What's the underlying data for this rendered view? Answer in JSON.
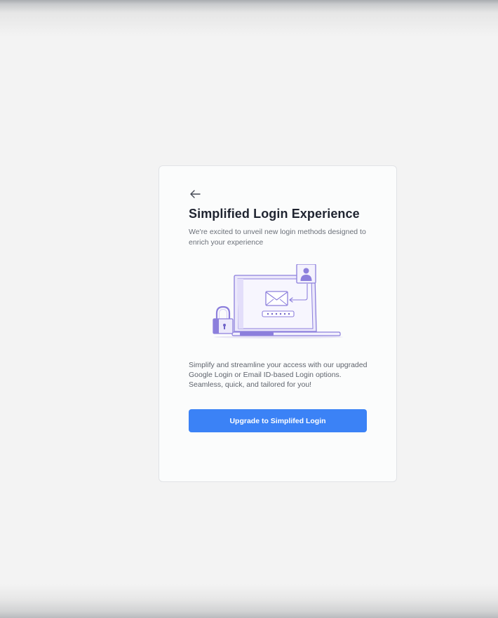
{
  "card": {
    "title": "Simplified Login Experience",
    "subtitle": "We're excited to unveil new login methods designed to enrich your experience",
    "description": "Simplify and streamline your access with our upgraded Google Login or Email ID-based Login options. Seamless, quick, and tailored for you!",
    "cta_label": "Upgrade to Simplifed Login",
    "back_icon": "arrow-left-icon",
    "illustration_icons": [
      "laptop-icon",
      "envelope-icon",
      "password-field-icon",
      "user-profile-icon",
      "padlock-icon"
    ]
  },
  "colors": {
    "accent": "#3b82f6",
    "illustration_purple": "#8c7fdc",
    "illustration_light": "#ece9fb",
    "title": "#1f2430",
    "body_text": "#6b7079",
    "background": "#f3f3f3",
    "card_background": "#fbfcfc"
  }
}
